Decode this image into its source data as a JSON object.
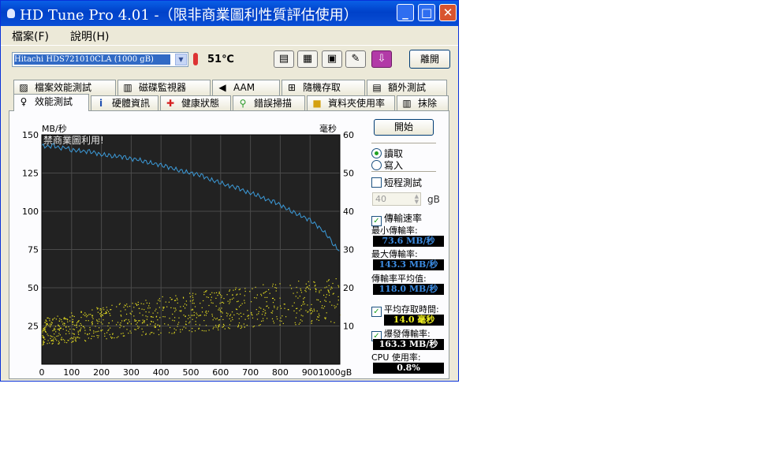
{
  "window": {
    "title": "HD Tune Pro 4.01 -（限非商業圖利性質評估使用）"
  },
  "menu": [
    "檔案(F)",
    "說明(H)"
  ],
  "toolbar": {
    "drive": "Hitachi HDS721010CLA     (1000 gB)",
    "temperature": "51℃",
    "exit_label": "離開",
    "icons": [
      "copy-text-icon",
      "copy-screenshot-icon",
      "save-icon",
      "options-icon",
      "download-icon"
    ]
  },
  "tabs": {
    "top": [
      {
        "label": "檔案效能測試",
        "icon": "file-benchmark-icon"
      },
      {
        "label": "磁碟監視器",
        "icon": "disk-monitor-icon"
      },
      {
        "label": "AAM",
        "icon": "speaker-icon"
      },
      {
        "label": "隨機存取",
        "icon": "random-access-icon"
      },
      {
        "label": "額外測試",
        "icon": "extra-tests-icon"
      }
    ],
    "bottom": [
      {
        "label": "效能測試",
        "icon": "benchmark-icon",
        "active": true
      },
      {
        "label": "硬體資訊",
        "icon": "info-icon"
      },
      {
        "label": "健康狀態",
        "icon": "health-cross-icon"
      },
      {
        "label": "錯誤掃描",
        "icon": "magnifier-icon"
      },
      {
        "label": "資料夾使用率",
        "icon": "folder-icon"
      },
      {
        "label": "抹除",
        "icon": "trash-icon"
      }
    ]
  },
  "benchmark": {
    "start_label": "開始",
    "read_label": "讀取",
    "write_label": "寫入",
    "short_test_label": "短程測試",
    "short_test_value": "40",
    "short_test_unit": "gB",
    "transfer_rate_label": "傳輸速率",
    "min_label": "最小傳輸率:",
    "min_value": "73.6 MB/秒",
    "max_label": "最大傳輸率:",
    "max_value": "143.3 MB/秒",
    "avg_label": "傳輸率平均值:",
    "avg_value": "118.0 MB/秒",
    "access_label": "平均存取時間:",
    "access_value": "14.0 毫秒",
    "burst_label": "爆發傳輸率:",
    "burst_value": "163.3 MB/秒",
    "cpu_label": "CPU 使用率:",
    "cpu_value": "0.8%",
    "accent_value_color": "#3c8be0",
    "access_value_color": "#f0f020",
    "white_value_color": "#ffffff"
  },
  "chart_data": {
    "type": "line",
    "watermark": "禁商業圖利用!",
    "y_left_label": "MB/秒",
    "y_right_label": "毫秒",
    "x_unit": "gB",
    "x_ticks": [
      "0",
      "100",
      "200",
      "300",
      "400",
      "500",
      "600",
      "700",
      "800",
      "900",
      "1000gB"
    ],
    "y_left_ticks": [
      "150",
      "125",
      "100",
      "75",
      "50",
      "25"
    ],
    "y_right_ticks": [
      "60",
      "50",
      "40",
      "30",
      "20",
      "10"
    ],
    "xlim": [
      0,
      1000
    ],
    "ylim_left": [
      0,
      150
    ],
    "ylim_right": [
      0,
      60
    ],
    "grid": true,
    "series": [
      {
        "type": "line",
        "axis": "left",
        "color": "#3c9ad8",
        "x": [
          0,
          20,
          40,
          60,
          80,
          100,
          120,
          140,
          160,
          180,
          200,
          220,
          240,
          260,
          280,
          300,
          320,
          340,
          360,
          380,
          400,
          420,
          440,
          460,
          480,
          500,
          520,
          540,
          560,
          580,
          600,
          620,
          640,
          660,
          680,
          700,
          720,
          740,
          760,
          780,
          800,
          820,
          840,
          860,
          880,
          900,
          920,
          940,
          960,
          980,
          1000
        ],
        "y": [
          143,
          142,
          143,
          141,
          142,
          140,
          140,
          139,
          139,
          138,
          137,
          137,
          136,
          136,
          135,
          134,
          134,
          133,
          132,
          131,
          130,
          129,
          128,
          127,
          126,
          125,
          124,
          123,
          121,
          120,
          119,
          117,
          116,
          115,
          113,
          112,
          111,
          109,
          107,
          106,
          104,
          102,
          100,
          98,
          96,
          94,
          91,
          88,
          84,
          78,
          74
        ]
      },
      {
        "type": "scatter",
        "axis": "right",
        "color": "#e8e020",
        "trend_x": [
          0,
          250,
          500,
          750,
          1000
        ],
        "trend_y_low": [
          5,
          7,
          8.5,
          10,
          11
        ],
        "trend_y_high": [
          12,
          16,
          19,
          21,
          23
        ]
      }
    ]
  }
}
